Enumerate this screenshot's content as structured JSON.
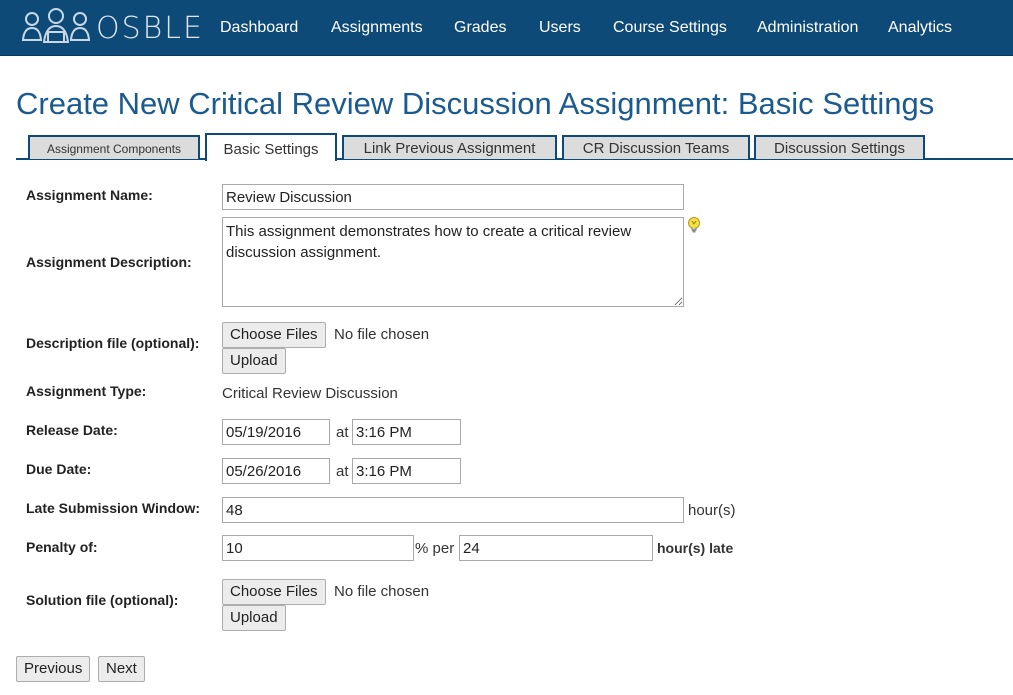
{
  "app": {
    "brand": "OSBLE",
    "nav": [
      "Dashboard",
      "Assignments",
      "Grades",
      "Users",
      "Course Settings",
      "Administration",
      "Analytics"
    ]
  },
  "page": {
    "title": "Create New Critical Review Discussion Assignment: Basic Settings"
  },
  "tabs": [
    {
      "label": "Assignment Components",
      "active": false
    },
    {
      "label": "Basic Settings",
      "active": true
    },
    {
      "label": "Link Previous Assignment",
      "active": false
    },
    {
      "label": "CR Discussion Teams",
      "active": false
    },
    {
      "label": "Discussion Settings",
      "active": false
    }
  ],
  "form": {
    "assignment_name": {
      "label": "Assignment Name:",
      "value": "Review Discussion"
    },
    "assignment_description": {
      "label": "Assignment Description:",
      "value": "This assignment demonstrates how to create a critical review discussion assignment."
    },
    "description_file": {
      "label": "Description file (optional):",
      "choose_label": "Choose Files",
      "status": "No file chosen",
      "upload_label": "Upload"
    },
    "assignment_type": {
      "label": "Assignment Type:",
      "value": "Critical Review Discussion"
    },
    "release_date": {
      "label": "Release Date:",
      "date": "05/19/2016",
      "at": "at",
      "time": "3:16 PM"
    },
    "due_date": {
      "label": "Due Date:",
      "date": "05/26/2016",
      "at": "at",
      "time": "3:16 PM"
    },
    "late_window": {
      "label": "Late Submission Window:",
      "value": "48",
      "unit": "hour(s)"
    },
    "penalty": {
      "label": "Penalty of:",
      "percent": "10",
      "per_text": "% per",
      "hours": "24",
      "unit": "hour(s) late"
    },
    "solution_file": {
      "label": "Solution file (optional):",
      "choose_label": "Choose Files",
      "status": "No file chosen",
      "upload_label": "Upload"
    }
  },
  "footer": {
    "previous_label": "Previous",
    "next_label": "Next"
  },
  "colors": {
    "navbar": "#0e4a78",
    "title": "#1a5a8f",
    "tab_inactive": "#dcdcdc"
  }
}
